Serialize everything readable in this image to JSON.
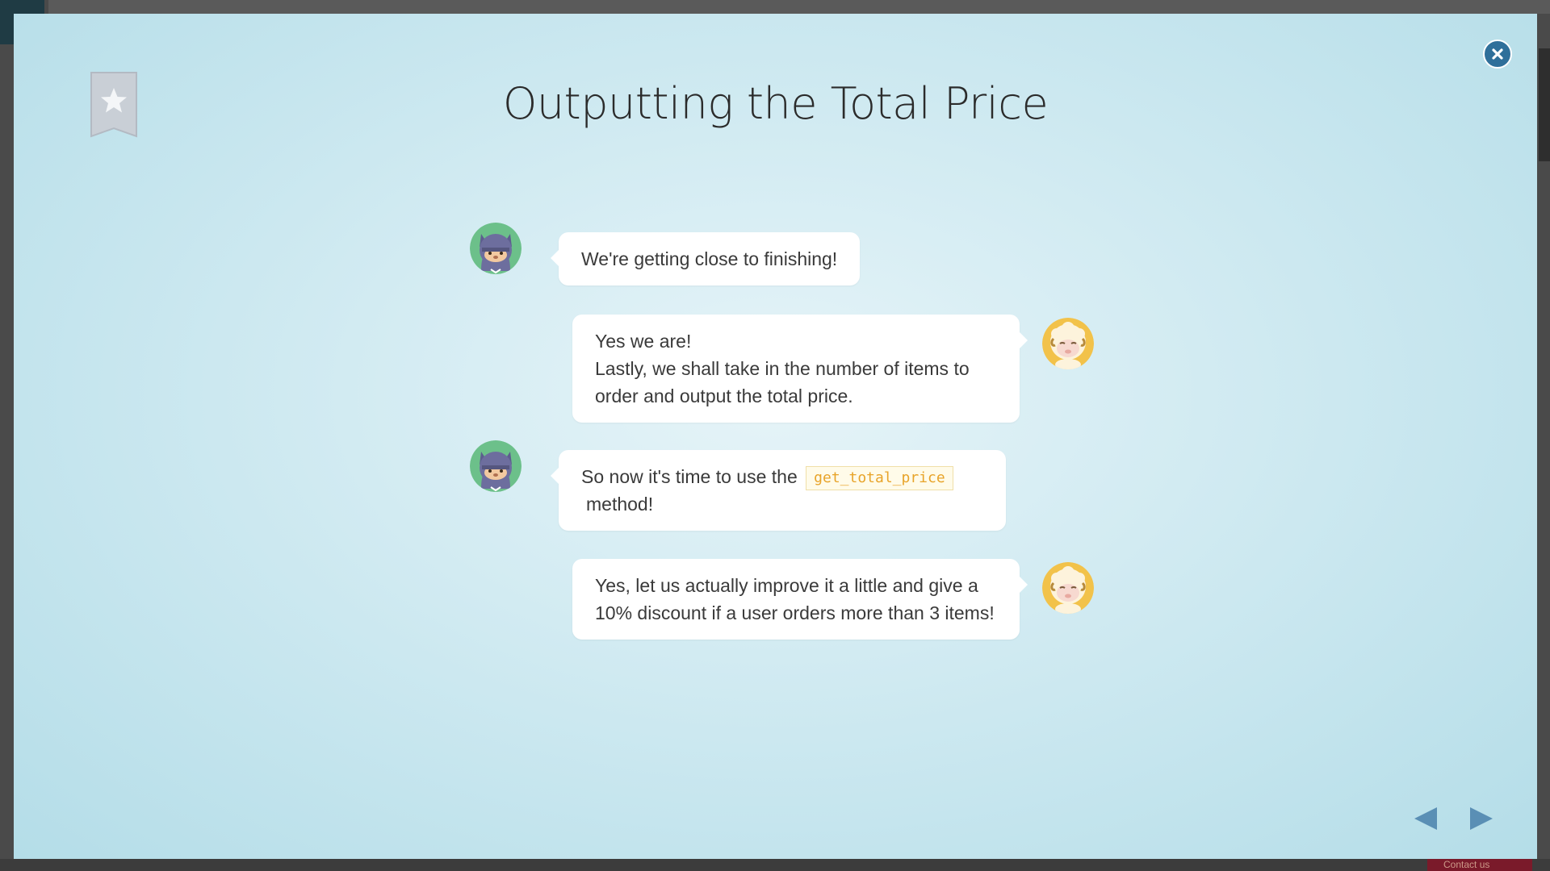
{
  "lesson": {
    "title": "Outputting the Total Price"
  },
  "messages": [
    {
      "speaker": "ninja-cat",
      "side": "left",
      "text": "We're getting close to finishing!"
    },
    {
      "speaker": "sheep",
      "side": "right",
      "lines": [
        "Yes we are!",
        "Lastly, we shall take in the number of items to order and output the total price."
      ]
    },
    {
      "speaker": "ninja-cat",
      "side": "left",
      "text_before": "So now it's time to use the",
      "code": "get_total_price",
      "text_after": "method!"
    },
    {
      "speaker": "sheep",
      "side": "right",
      "text": "Yes, let us actually improve it a little and give a 10% discount if a user orders more than 3 items!"
    }
  ],
  "background": {
    "contact_label": "Contact us"
  },
  "colors": {
    "close_button": "#2f6f9a",
    "nav_arrow": "#5a8fb5",
    "code_text": "#e8a42a",
    "cat_avatar_bg": "#6cc08a",
    "sheep_avatar_bg": "#f2c24a"
  },
  "icons": {
    "close": "close-icon",
    "bookmark": "bookmark-star-icon",
    "prev": "previous-arrow-icon",
    "next": "next-arrow-icon"
  }
}
